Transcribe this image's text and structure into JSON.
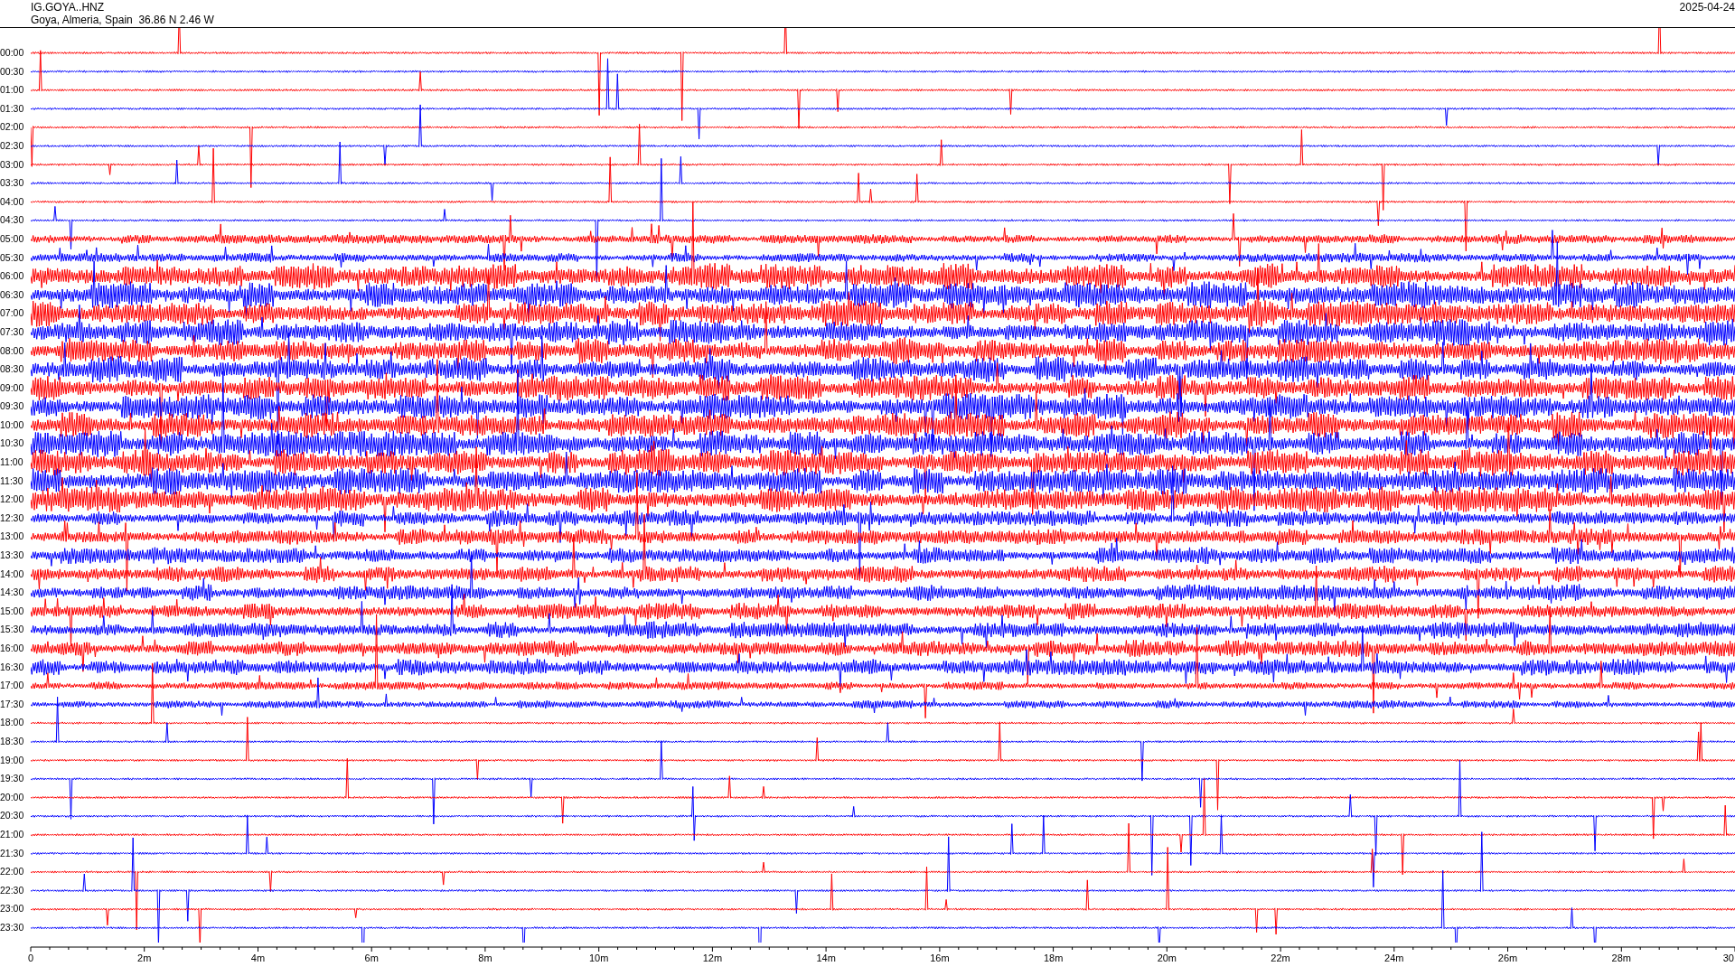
{
  "header": {
    "station": "IG.GOYA..HNZ",
    "location": "Goya, Almeria, Spain  36.86 N 2.46 W",
    "date": "2025-04-24"
  },
  "rows": [
    {
      "label": "00:00",
      "color": "#ff0000"
    },
    {
      "label": "00:30",
      "color": "#0000ff"
    },
    {
      "label": "01:00",
      "color": "#ff0000"
    },
    {
      "label": "01:30",
      "color": "#0000ff"
    },
    {
      "label": "02:00",
      "color": "#ff0000"
    },
    {
      "label": "02:30",
      "color": "#0000ff"
    },
    {
      "label": "03:00",
      "color": "#ff0000"
    },
    {
      "label": "03:30",
      "color": "#0000ff"
    },
    {
      "label": "04:00",
      "color": "#ff0000"
    },
    {
      "label": "04:30",
      "color": "#0000ff"
    },
    {
      "label": "05:00",
      "color": "#ff0000"
    },
    {
      "label": "05:30",
      "color": "#0000ff"
    },
    {
      "label": "06:00",
      "color": "#ff0000"
    },
    {
      "label": "06:30",
      "color": "#0000ff"
    },
    {
      "label": "07:00",
      "color": "#ff0000"
    },
    {
      "label": "07:30",
      "color": "#0000ff"
    },
    {
      "label": "08:00",
      "color": "#ff0000"
    },
    {
      "label": "08:30",
      "color": "#0000ff"
    },
    {
      "label": "09:00",
      "color": "#ff0000"
    },
    {
      "label": "09:30",
      "color": "#0000ff"
    },
    {
      "label": "10:00",
      "color": "#ff0000"
    },
    {
      "label": "10:30",
      "color": "#0000ff"
    },
    {
      "label": "11:00",
      "color": "#ff0000"
    },
    {
      "label": "11:30",
      "color": "#0000ff"
    },
    {
      "label": "12:00",
      "color": "#ff0000"
    },
    {
      "label": "12:30",
      "color": "#0000ff"
    },
    {
      "label": "13:00",
      "color": "#ff0000"
    },
    {
      "label": "13:30",
      "color": "#0000ff"
    },
    {
      "label": "14:00",
      "color": "#ff0000"
    },
    {
      "label": "14:30",
      "color": "#0000ff"
    },
    {
      "label": "15:00",
      "color": "#ff0000"
    },
    {
      "label": "15:30",
      "color": "#0000ff"
    },
    {
      "label": "16:00",
      "color": "#ff0000"
    },
    {
      "label": "16:30",
      "color": "#0000ff"
    },
    {
      "label": "17:00",
      "color": "#ff0000"
    },
    {
      "label": "17:30",
      "color": "#0000ff"
    },
    {
      "label": "18:00",
      "color": "#ff0000"
    },
    {
      "label": "18:30",
      "color": "#0000ff"
    },
    {
      "label": "19:00",
      "color": "#ff0000"
    },
    {
      "label": "19:30",
      "color": "#0000ff"
    },
    {
      "label": "20:00",
      "color": "#ff0000"
    },
    {
      "label": "20:30",
      "color": "#0000ff"
    },
    {
      "label": "21:00",
      "color": "#ff0000"
    },
    {
      "label": "21:30",
      "color": "#0000ff"
    },
    {
      "label": "22:00",
      "color": "#ff0000"
    },
    {
      "label": "22:30",
      "color": "#0000ff"
    },
    {
      "label": "23:00",
      "color": "#ff0000"
    },
    {
      "label": "23:30",
      "color": "#0000ff"
    }
  ],
  "x_axis": {
    "labels": [
      "0",
      "2m",
      "4m",
      "6m",
      "8m",
      "10m",
      "12m",
      "14m",
      "16m",
      "18m",
      "20m",
      "22m",
      "24m",
      "26m",
      "28m",
      "30"
    ]
  }
}
